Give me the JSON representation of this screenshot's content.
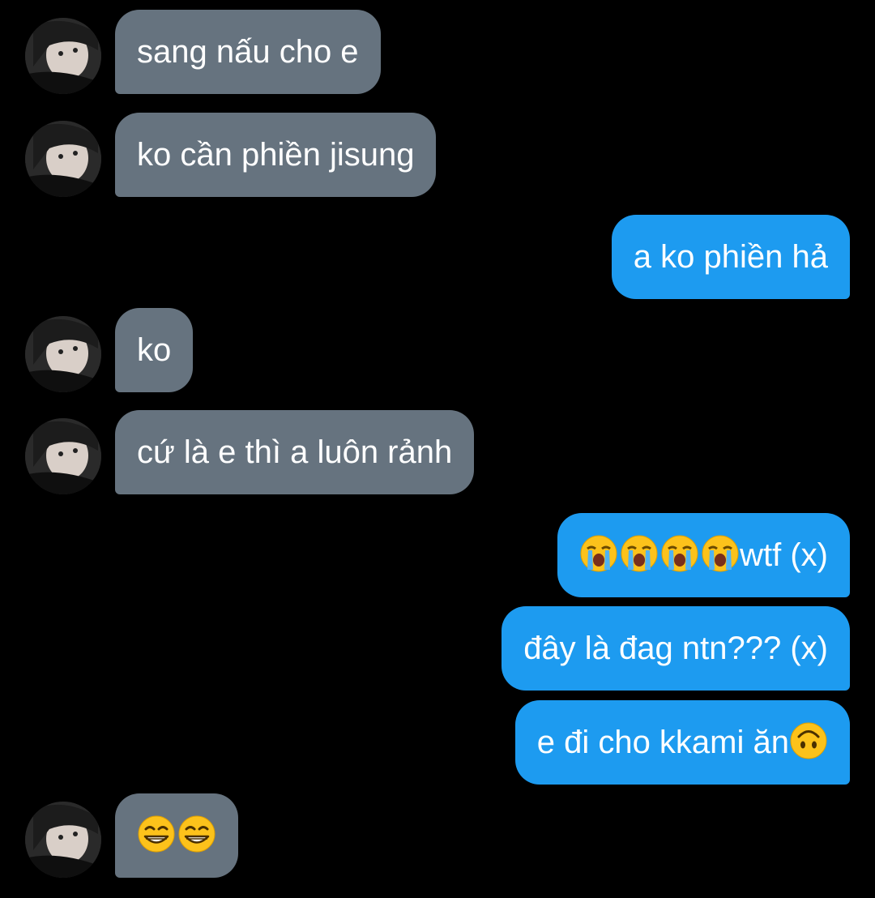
{
  "conversation": {
    "messages": [
      {
        "side": "incoming",
        "text": "sang nấu cho e"
      },
      {
        "side": "incoming",
        "text": "ko cần phiền jisung"
      },
      {
        "side": "outgoing",
        "text": "a ko phiền hả"
      },
      {
        "side": "incoming",
        "text": "ko"
      },
      {
        "side": "incoming",
        "text": "cứ là e thì a luôn rảnh"
      },
      {
        "side": "outgoing",
        "text": "wtf (x)",
        "emojis": [
          "loudly-crying-face-icon",
          "loudly-crying-face-icon",
          "loudly-crying-face-icon",
          "loudly-crying-face-icon"
        ]
      },
      {
        "side": "outgoing",
        "text": "đây là đag ntn??? (x)"
      },
      {
        "side": "outgoing",
        "text": "e đi cho kkami ăn",
        "trailing_emoji": "upside-down-face-icon"
      },
      {
        "side": "incoming",
        "text": "",
        "emojis": [
          "beaming-face-icon",
          "beaming-face-icon"
        ]
      }
    ]
  },
  "colors": {
    "background": "#000000",
    "incoming_bubble": "#66737f",
    "outgoing_bubble": "#1d9bf0",
    "text": "#ffffff",
    "emoji_yellow": "#fcc21b"
  }
}
